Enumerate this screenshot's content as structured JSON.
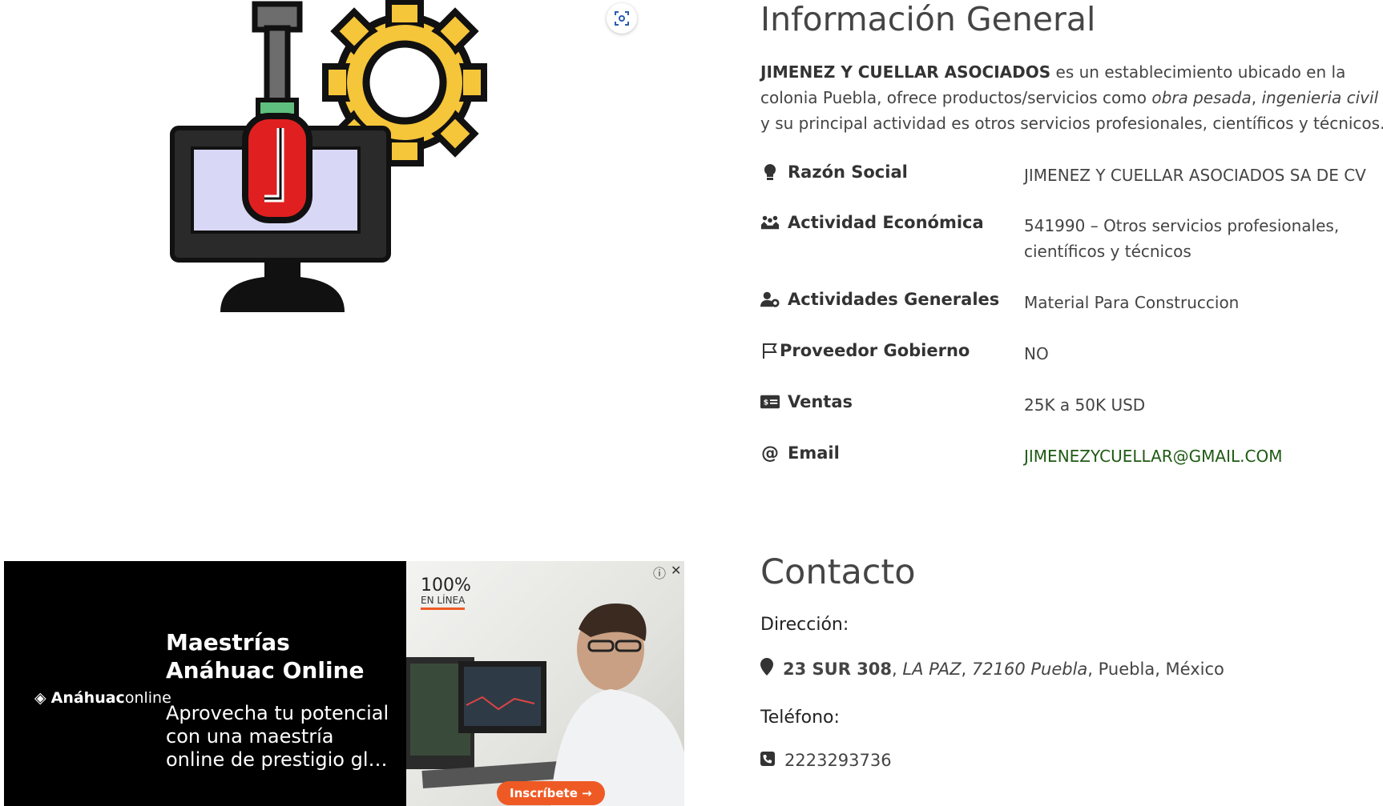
{
  "info": {
    "title": "Información General",
    "desc_company": "JIMENEZ Y CUELLAR ASOCIADOS",
    "desc_part1": " es un establecimiento ubicado en la colonia Puebla, ofrece productos/servicios como ",
    "desc_item1": "obra pesada",
    "desc_sep": ", ",
    "desc_item2": "ingenieria civil",
    "desc_part2": " y su principal actividad es otros servicios profesionales, científicos y técnicos.",
    "rows": [
      {
        "label": "Razón Social",
        "value": "JIMENEZ Y CUELLAR ASOCIADOS SA DE CV",
        "icon": "lightbulb-icon"
      },
      {
        "label": "Actividad Económica",
        "value": "541990 – Otros servicios profesionales, científicos y técnicos",
        "icon": "people-icon"
      },
      {
        "label": "Actividades Generales",
        "value": "Material Para Construccion",
        "icon": "user-gear-icon"
      },
      {
        "label": "Proveedor Gobierno",
        "value": "NO",
        "icon": "flag-icon"
      },
      {
        "label": "Ventas",
        "value": "25K a 50K USD",
        "icon": "money-icon"
      },
      {
        "label": "Email",
        "value": "JIMENEZYCUELLAR@GMAIL.COM",
        "icon": "at-icon"
      }
    ]
  },
  "contact": {
    "title": "Contacto",
    "address_label": "Dirección:",
    "street": "23 SUR 308",
    "sep1": ", ",
    "colony": "LA PAZ",
    "sep2": ", ",
    "zip_city": "72160 Puebla",
    "rest": ", Puebla, México",
    "phone_label": "Teléfono:",
    "phone": "2223293736"
  },
  "ad": {
    "brand_bold": "Anáhuac",
    "brand_light": "online",
    "headline": "Maestrías Anáhuac Online",
    "body": "Aprovecha tu potencial con una maestría online de prestigio gl…",
    "badge_big": "100%",
    "badge_small": "EN LÍNEA",
    "cta": "Inscríbete →",
    "info_glyph": "ⓘ",
    "close_glyph": "✕"
  },
  "colors": {
    "gear": "#f5c53a",
    "handle": "#e02020",
    "screen": "#d8d8f6",
    "email": "#1f5a14",
    "ad_cta": "#ef5a24"
  }
}
